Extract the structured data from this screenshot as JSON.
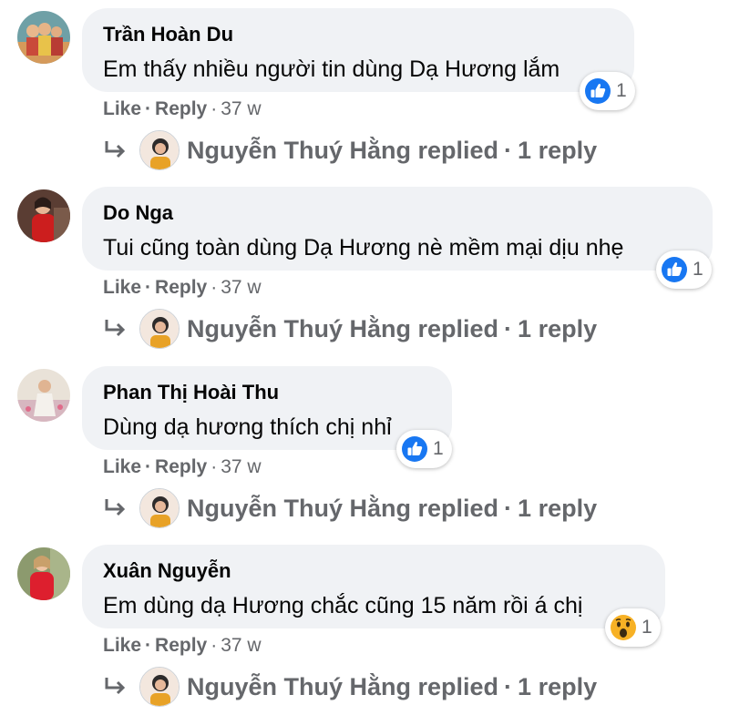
{
  "comments": [
    {
      "author": "Trần Hoàn Du",
      "text": "Em thấy nhiều người tin dùng Dạ Hương lắm",
      "reaction_icon": "like-icon",
      "reaction_count": "1",
      "like_label": "Like",
      "reply_label": "Reply",
      "age": "37 w",
      "replies": {
        "name": "Nguyễn Thuý Hằng replied",
        "count_label": "1 reply"
      }
    },
    {
      "author": "Do Nga",
      "text": "Tui cũng toàn dùng Dạ Hương nè mềm mại dịu nhẹ",
      "reaction_icon": "like-icon",
      "reaction_count": "1",
      "like_label": "Like",
      "reply_label": "Reply",
      "age": "37 w",
      "replies": {
        "name": "Nguyễn Thuý Hằng replied",
        "count_label": "1 reply"
      }
    },
    {
      "author": "Phan Thị Hoài Thu",
      "text": "Dùng dạ hương thích chị nhỉ",
      "reaction_icon": "like-icon",
      "reaction_count": "1",
      "like_label": "Like",
      "reply_label": "Reply",
      "age": "37 w",
      "replies": {
        "name": "Nguyễn Thuý Hằng replied",
        "count_label": "1 reply"
      }
    },
    {
      "author": "Xuân Nguyễn",
      "text": "Em dùng dạ Hương chắc cũng 15 năm rồi á chị",
      "reaction_icon": "wow-icon",
      "reaction_count": "1",
      "like_label": "Like",
      "reply_label": "Reply",
      "age": "37 w",
      "replies": {
        "name": "Nguyễn Thuý Hằng replied",
        "count_label": "1 reply"
      }
    }
  ],
  "colors": {
    "bubble_bg": "#f0f2f5",
    "like_blue": "#1877f2",
    "meta_gray": "#65676b",
    "wow_yellow": "#f7b125"
  }
}
